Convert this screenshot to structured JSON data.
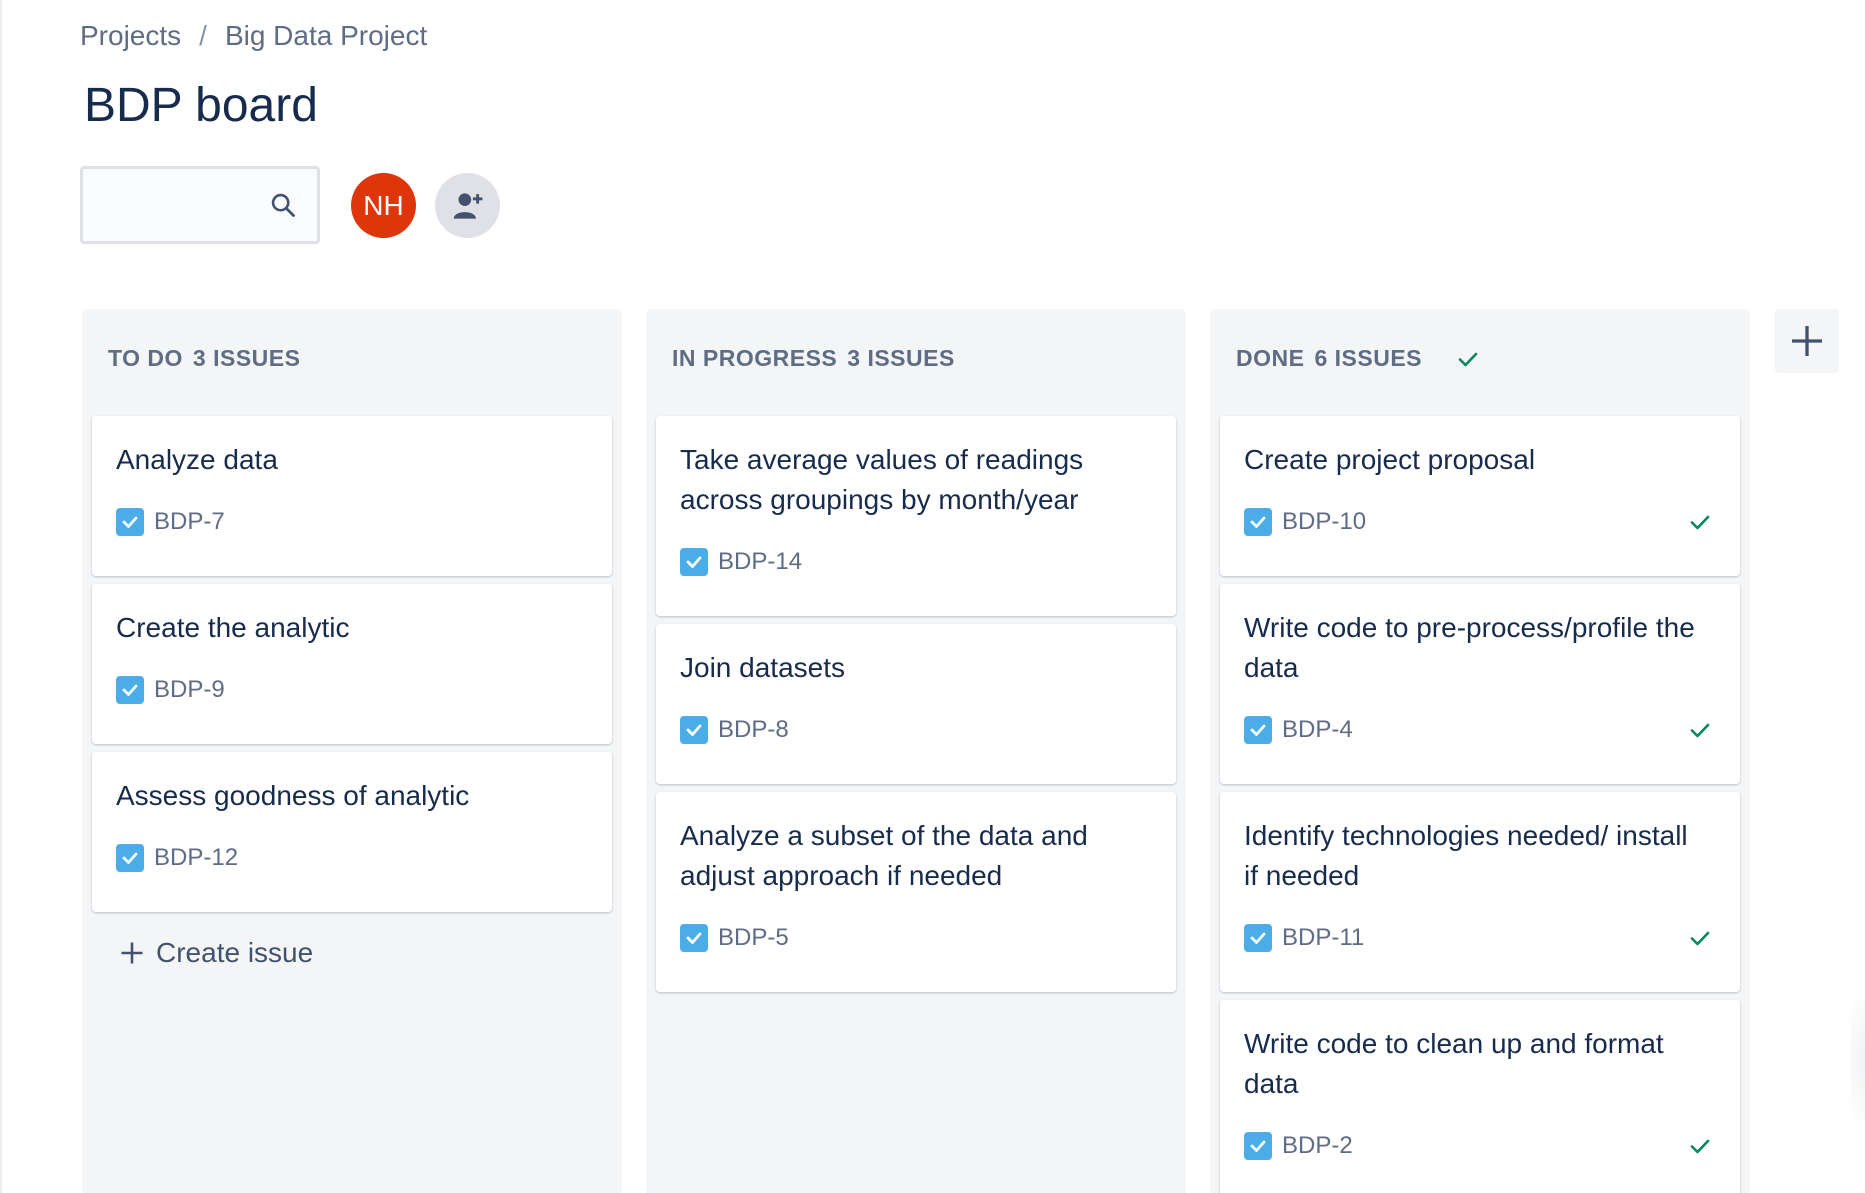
{
  "breadcrumb": {
    "projects": "Projects",
    "separator": "/",
    "project": "Big Data Project"
  },
  "board": {
    "title": "BDP board"
  },
  "search": {
    "placeholder": "",
    "value": ""
  },
  "members": {
    "avatar_initials": "NH",
    "avatar_color": "#de350b"
  },
  "create_issue_label": "Create issue",
  "colors": {
    "task_icon": "#4bade8",
    "done_check": "#00875a",
    "column_bg": "#f4f5f7"
  },
  "columns": [
    {
      "name": "TO DO",
      "count_label": "3 ISSUES",
      "cards": [
        {
          "title": "Analyze data",
          "key": "BDP-7"
        },
        {
          "title": "Create the analytic",
          "key": "BDP-9"
        },
        {
          "title": "Assess goodness of analytic",
          "key": "BDP-12"
        }
      ]
    },
    {
      "name": "IN PROGRESS",
      "count_label": "3 ISSUES",
      "cards": [
        {
          "title": "Take average values of readings across groupings by month/year",
          "key": "BDP-14"
        },
        {
          "title": "Join datasets",
          "key": "BDP-8"
        },
        {
          "title": "Analyze a subset of the data and adjust approach if needed",
          "key": "BDP-5"
        }
      ]
    },
    {
      "name": "DONE",
      "count_label": "6 ISSUES",
      "cards": [
        {
          "title": "Create project proposal",
          "key": "BDP-10"
        },
        {
          "title": "Write code to pre-process/profile the data",
          "key": "BDP-4"
        },
        {
          "title": "Identify technologies needed/ install if needed",
          "key": "BDP-11"
        },
        {
          "title": "Write code to clean up and format data",
          "key": "BDP-2"
        }
      ]
    }
  ]
}
